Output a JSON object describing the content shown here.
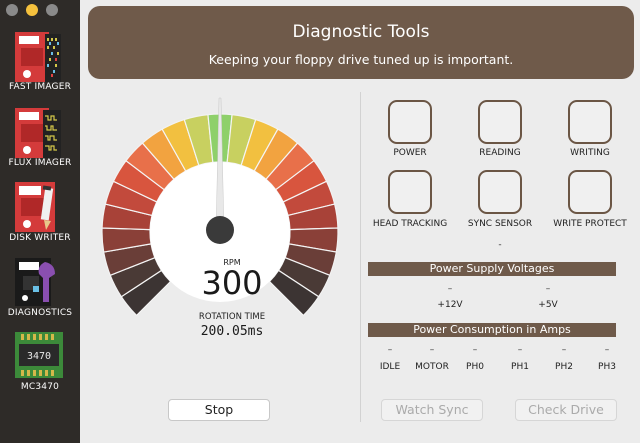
{
  "sidebar": {
    "items": [
      {
        "label": "FAST IMAGER",
        "icon": "fast-imager-icon"
      },
      {
        "label": "FLUX IMAGER",
        "icon": "flux-imager-icon"
      },
      {
        "label": "DISK WRITER",
        "icon": "disk-writer-icon"
      },
      {
        "label": "DIAGNOSTICS",
        "icon": "diagnostics-icon"
      },
      {
        "label": "MC3470",
        "icon": "chip-icon"
      }
    ],
    "chip_text": "3470"
  },
  "header": {
    "title": "Diagnostic Tools",
    "subtitle": "Keeping your floppy drive tuned up is important."
  },
  "gauge": {
    "rpm_label": "RPM",
    "rpm_value": "300",
    "rotation_label": "ROTATION TIME",
    "rotation_value": "200.05ms",
    "colors": [
      "#3c3433",
      "#4a3a36",
      "#6a3e38",
      "#8a4038",
      "#a84238",
      "#c24a3c",
      "#d8553e",
      "#e8704a",
      "#f2a340",
      "#f2c040",
      "#c8d060",
      "#8ed06a",
      "#c8d060",
      "#f2c040",
      "#f2a340",
      "#e8704a",
      "#d8553e",
      "#c24a3c",
      "#a84238",
      "#8a4038",
      "#6a3e38",
      "#4a3a36",
      "#3c3433"
    ]
  },
  "buttons": {
    "stop": "Stop",
    "watch_sync": "Watch Sync",
    "check_drive": "Check Drive"
  },
  "indicators": {
    "row1": [
      "POWER",
      "READING",
      "WRITING"
    ],
    "row2": [
      "HEAD TRACKING",
      "SYNC SENSOR",
      "WRITE PROTECT"
    ],
    "sync_value": "-"
  },
  "voltages": {
    "title": "Power Supply Voltages",
    "items": [
      {
        "value": "–",
        "label": "+12V"
      },
      {
        "value": "–",
        "label": "+5V"
      }
    ]
  },
  "consumption": {
    "title": "Power Consumption in Amps",
    "items": [
      {
        "value": "–",
        "label": "IDLE"
      },
      {
        "value": "–",
        "label": "MOTOR"
      },
      {
        "value": "–",
        "label": "PH0"
      },
      {
        "value": "–",
        "label": "PH1"
      },
      {
        "value": "–",
        "label": "PH2"
      },
      {
        "value": "–",
        "label": "PH3"
      }
    ]
  }
}
